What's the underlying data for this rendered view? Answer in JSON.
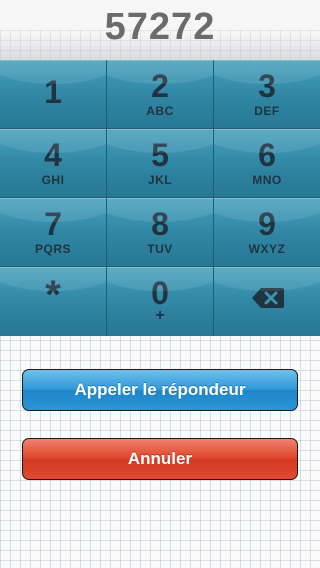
{
  "display": {
    "number": "57272"
  },
  "keypad": {
    "rows": [
      [
        {
          "digit": "1",
          "letters": ""
        },
        {
          "digit": "2",
          "letters": "ABC"
        },
        {
          "digit": "3",
          "letters": "DEF"
        }
      ],
      [
        {
          "digit": "4",
          "letters": "GHI"
        },
        {
          "digit": "5",
          "letters": "JKL"
        },
        {
          "digit": "6",
          "letters": "MNO"
        }
      ],
      [
        {
          "digit": "7",
          "letters": "PQRS"
        },
        {
          "digit": "8",
          "letters": "TUV"
        },
        {
          "digit": "9",
          "letters": "WXYZ"
        }
      ]
    ],
    "star": "*",
    "zero": {
      "digit": "0",
      "letters": "+"
    },
    "backspace_icon": "backspace-icon"
  },
  "buttons": {
    "call_label": "Appeler le répondeur",
    "cancel_label": "Annuler"
  },
  "colors": {
    "key_blue": "#2f8aa7",
    "call_button": "#2f98d8",
    "cancel_button": "#e0452c",
    "number_text": "#6b6b6b"
  }
}
